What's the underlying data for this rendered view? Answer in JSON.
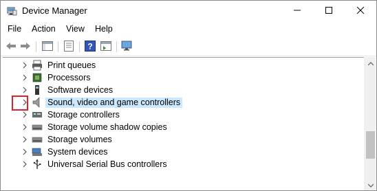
{
  "window": {
    "title": "Device Manager",
    "icon": "device-manager-icon",
    "controls": {
      "minimize": "minimize-icon",
      "maximize": "maximize-icon",
      "close": "close-icon"
    }
  },
  "menu": [
    {
      "label": "File"
    },
    {
      "label": "Action"
    },
    {
      "label": "View"
    },
    {
      "label": "Help"
    }
  ],
  "toolbar": [
    {
      "name": "back-button",
      "icon": "arrow-left-icon"
    },
    {
      "name": "forward-button",
      "icon": "arrow-right-icon"
    },
    {
      "name": "show-hide-console-tree-button",
      "icon": "console-tree-icon"
    },
    {
      "name": "properties-button",
      "icon": "properties-icon"
    },
    {
      "name": "help-button",
      "icon": "help-icon"
    },
    {
      "name": "action-pane-button",
      "icon": "action-pane-icon"
    },
    {
      "name": "scan-hardware-button",
      "icon": "monitor-icon"
    }
  ],
  "tree": {
    "items": [
      {
        "label": "Print queues",
        "icon": "printer-icon",
        "selected": false
      },
      {
        "label": "Processors",
        "icon": "processor-icon",
        "selected": false
      },
      {
        "label": "Software devices",
        "icon": "software-device-icon",
        "selected": false
      },
      {
        "label": "Sound, video and game controllers",
        "icon": "speaker-icon",
        "selected": true
      },
      {
        "label": "Storage controllers",
        "icon": "storage-controller-icon",
        "selected": false
      },
      {
        "label": "Storage volume shadow copies",
        "icon": "drive-icon",
        "selected": false
      },
      {
        "label": "Storage volumes",
        "icon": "drive-icon",
        "selected": false
      },
      {
        "label": "System devices",
        "icon": "system-device-icon",
        "selected": false
      },
      {
        "label": "Universal Serial Bus controllers",
        "icon": "usb-icon",
        "selected": false
      }
    ]
  },
  "colors": {
    "selection": "#cce8ff",
    "highlight_box": "#e0202a"
  }
}
